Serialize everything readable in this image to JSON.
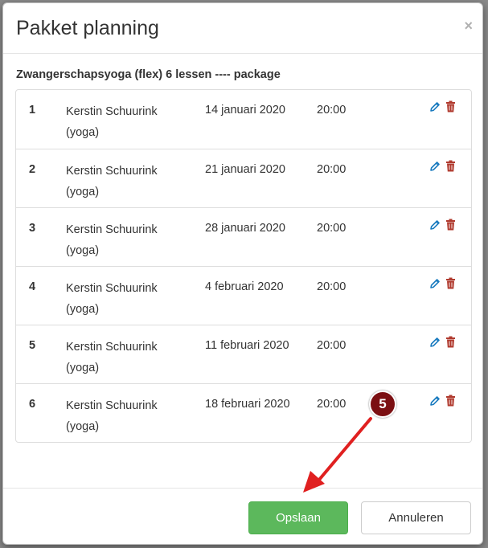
{
  "modal": {
    "title": "Pakket planning",
    "close_label": "×",
    "package_title": "Zwangerschapsyoga (flex) 6 lessen ---- package"
  },
  "lessons": [
    {
      "num": "1",
      "teacher": "Kerstin Schuurink",
      "category": "(yoga)",
      "date": "14 januari 2020",
      "time": "20:00"
    },
    {
      "num": "2",
      "teacher": "Kerstin Schuurink",
      "category": "(yoga)",
      "date": "21 januari 2020",
      "time": "20:00"
    },
    {
      "num": "3",
      "teacher": "Kerstin Schuurink",
      "category": "(yoga)",
      "date": "28 januari 2020",
      "time": "20:00"
    },
    {
      "num": "4",
      "teacher": "Kerstin Schuurink",
      "category": "(yoga)",
      "date": "4 februari 2020",
      "time": "20:00"
    },
    {
      "num": "5",
      "teacher": "Kerstin Schuurink",
      "category": "(yoga)",
      "date": "11 februari 2020",
      "time": "20:00"
    },
    {
      "num": "6",
      "teacher": "Kerstin Schuurink",
      "category": "(yoga)",
      "date": "18 februari 2020",
      "time": "20:00"
    }
  ],
  "icons": {
    "edit": "pencil-icon",
    "delete": "trash-icon"
  },
  "footer": {
    "save_label": "Opslaan",
    "cancel_label": "Annuleren"
  },
  "annotation": {
    "step_number": "5"
  },
  "colors": {
    "save_button": "#5cb85c",
    "edit_icon": "#1a7bbf",
    "delete_icon": "#b03a2e",
    "step_badge": "#7b0f12",
    "arrow": "#e02020"
  }
}
